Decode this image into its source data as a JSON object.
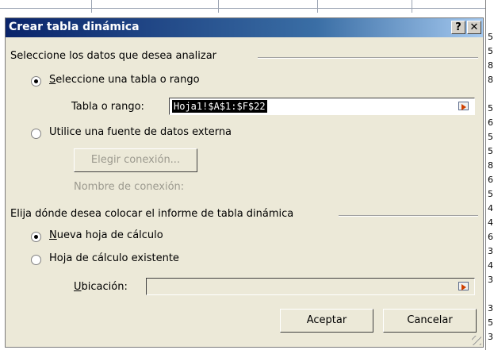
{
  "dialog": {
    "title": "Crear tabla dinámica",
    "help_label": "?",
    "close_label": "✕",
    "section1": {
      "label": "Seleccione los datos que desea analizar",
      "option_table": "Seleccione una tabla o rango",
      "table_range_label": "Tabla o rango:",
      "table_range_value": "Hoja1!$A$1:$F$22",
      "option_external": "Utilice una fuente de datos externa",
      "choose_connection": "Elegir conexión...",
      "connection_name_label": "Nombre de conexión:"
    },
    "section2": {
      "label": "Elija dónde desea colocar el informe de tabla dinámica",
      "option_new_sheet": "Nueva hoja de cálculo",
      "option_existing_sheet": "Hoja de cálculo existente",
      "location_label": "Ubicación:",
      "location_value": ""
    },
    "ok_label": "Aceptar",
    "cancel_label": "Cancelar",
    "selected_source": "table_range",
    "selected_destination": "new_sheet"
  },
  "sheet_right_chars": [
    "5",
    "5",
    "8",
    "8",
    "",
    "5",
    "6",
    "5",
    "5",
    "8",
    "6",
    "5",
    "4",
    "4",
    "6",
    "3",
    "4",
    "3",
    "",
    "3",
    "5",
    "3"
  ],
  "colors": {
    "title_start": "#0a246a",
    "title_end": "#a6caf0",
    "dialog_bg": "#ece9d8"
  }
}
